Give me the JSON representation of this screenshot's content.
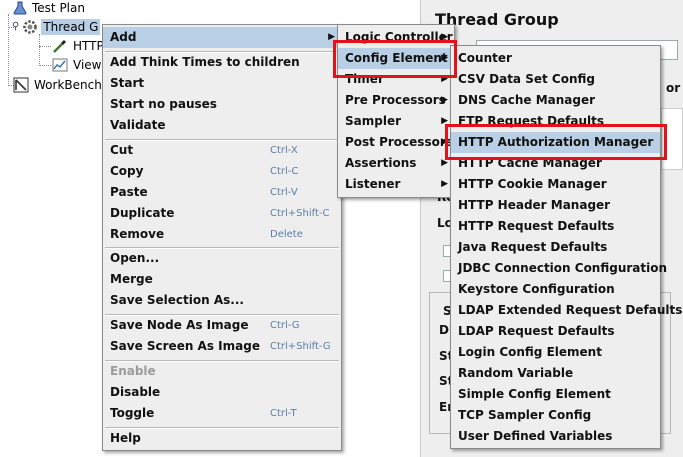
{
  "tree": {
    "test_plan": "Test Plan",
    "thread_group": "Thread G",
    "http_child": "HTTP",
    "view_child": "View",
    "workbench": "WorkBench"
  },
  "panel": {
    "title": "Thread Group",
    "labels": [
      "or",
      "Re",
      "Lo",
      "S",
      "Du",
      "St",
      "St",
      "En"
    ]
  },
  "context_menu": {
    "items": [
      {
        "label": "Add",
        "submenu": true,
        "highlighted": true
      },
      {
        "label": "Add Think Times to children"
      },
      {
        "label": "Start"
      },
      {
        "label": "Start no pauses"
      },
      {
        "label": "Validate"
      },
      {
        "label": "Cut",
        "shortcut": "Ctrl-X"
      },
      {
        "label": "Copy",
        "shortcut": "Ctrl-C"
      },
      {
        "label": "Paste",
        "shortcut": "Ctrl-V"
      },
      {
        "label": "Duplicate",
        "shortcut": "Ctrl+Shift-C"
      },
      {
        "label": "Remove",
        "shortcut": "Delete"
      },
      {
        "label": "Open..."
      },
      {
        "label": "Merge"
      },
      {
        "label": "Save Selection As..."
      },
      {
        "label": "Save Node As Image",
        "shortcut": "Ctrl-G"
      },
      {
        "label": "Save Screen As Image",
        "shortcut": "Ctrl+Shift-G"
      },
      {
        "label": "Enable",
        "disabled": true
      },
      {
        "label": "Disable"
      },
      {
        "label": "Toggle",
        "shortcut": "Ctrl-T"
      },
      {
        "label": "Help"
      }
    ]
  },
  "add_menu": {
    "items": [
      {
        "label": "Logic Controller",
        "submenu": true
      },
      {
        "label": "Config Element",
        "submenu": true,
        "highlighted": true
      },
      {
        "label": "Timer",
        "submenu": true
      },
      {
        "label": "Pre Processors",
        "submenu": true
      },
      {
        "label": "Sampler",
        "submenu": true
      },
      {
        "label": "Post Processors",
        "submenu": true
      },
      {
        "label": "Assertions",
        "submenu": true
      },
      {
        "label": "Listener",
        "submenu": true
      }
    ]
  },
  "config_menu": {
    "items": [
      {
        "label": "Counter"
      },
      {
        "label": "CSV Data Set Config"
      },
      {
        "label": "DNS Cache Manager"
      },
      {
        "label": "FTP Request Defaults"
      },
      {
        "label": "HTTP Authorization Manager",
        "highlighted": true
      },
      {
        "label": "HTTP Cache Manager"
      },
      {
        "label": "HTTP Cookie Manager"
      },
      {
        "label": "HTTP Header Manager"
      },
      {
        "label": "HTTP Request Defaults"
      },
      {
        "label": "Java Request Defaults"
      },
      {
        "label": "JDBC Connection Configuration"
      },
      {
        "label": "Keystore Configuration"
      },
      {
        "label": "LDAP Extended Request Defaults"
      },
      {
        "label": "LDAP Request Defaults"
      },
      {
        "label": "Login Config Element"
      },
      {
        "label": "Random Variable"
      },
      {
        "label": "Simple Config Element"
      },
      {
        "label": "TCP Sampler Config"
      },
      {
        "label": "User Defined Variables"
      }
    ]
  },
  "colors": {
    "highlight": "#b8cfe5",
    "annotation_red": "#e3111b",
    "menu_bg": "#eeeeee",
    "shortcut": "#5a7ea8"
  }
}
